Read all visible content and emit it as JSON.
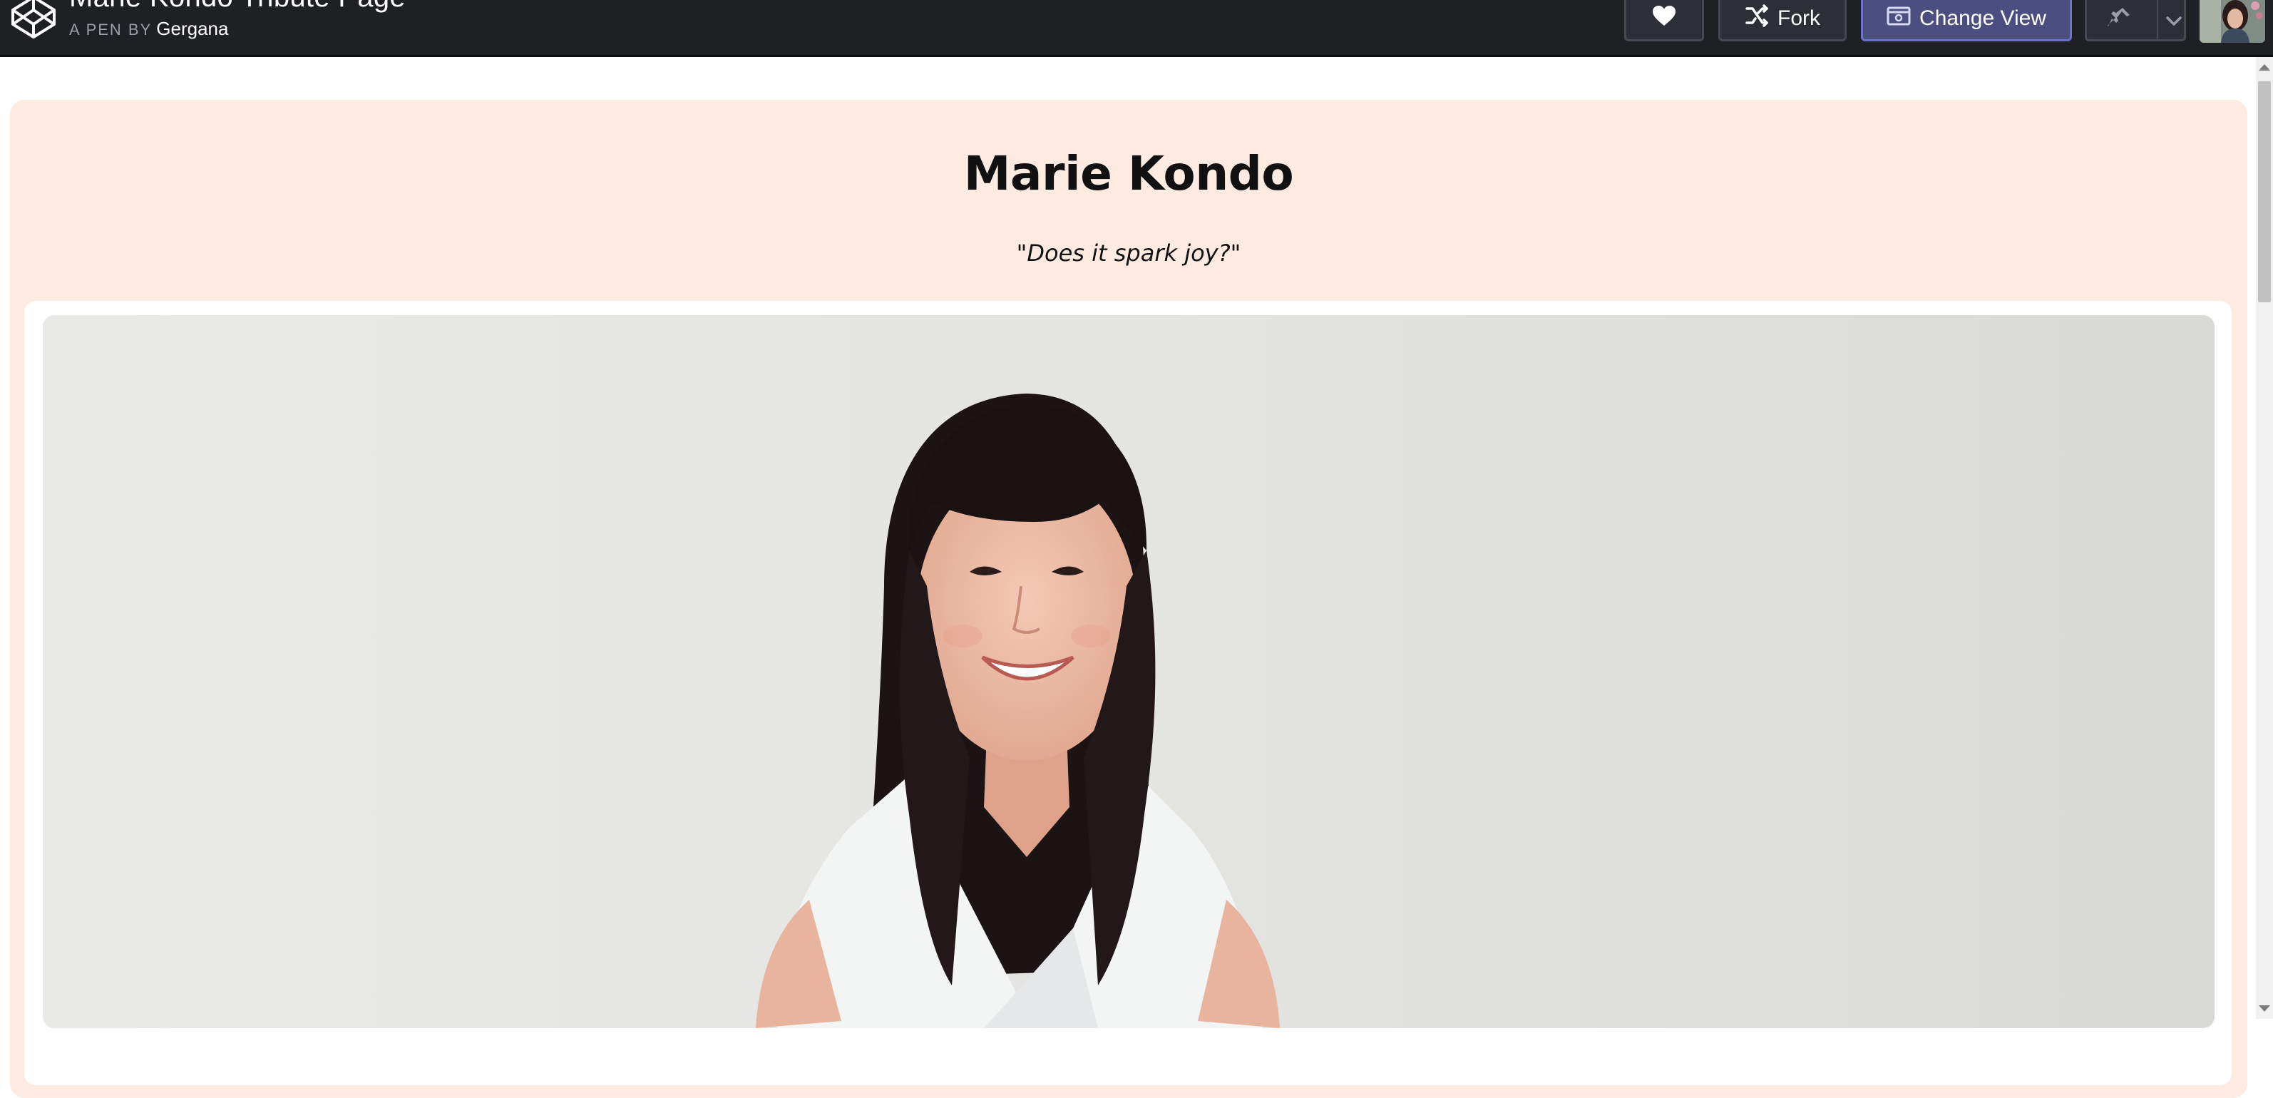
{
  "header": {
    "pen_title": "Marie Kondo Tribute Page",
    "by_label": "A PEN BY",
    "author": "Gergana",
    "buttons": {
      "fork_label": "Fork",
      "change_view_label": "Change View"
    },
    "icons": [
      "codepen-logo-icon",
      "heart-icon",
      "fork-icon",
      "change-view-icon",
      "pin-icon",
      "chevron-down-icon"
    ]
  },
  "page": {
    "title": "Marie Kondo",
    "quote": "\"Does it spark joy?\""
  },
  "colors": {
    "topbar": "#1f2024",
    "page_background": "#fdebe2",
    "change_view_button": "#4a4f80",
    "change_view_border": "#6a71c9"
  }
}
